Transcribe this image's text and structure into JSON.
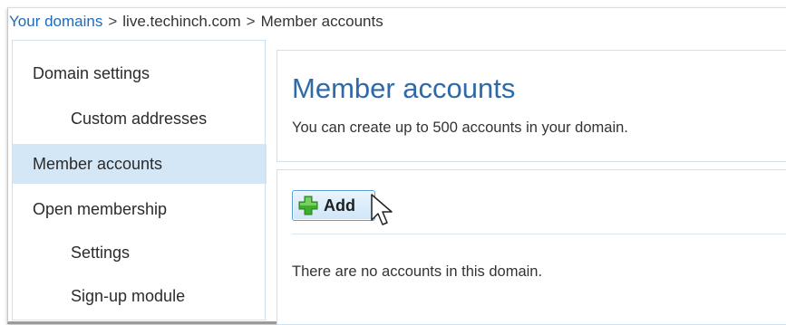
{
  "breadcrumb": {
    "root": "Your domains",
    "separator": ">",
    "domain": "live.techinch.com",
    "current": "Member accounts"
  },
  "sidebar": {
    "items": [
      {
        "label": "Domain settings",
        "level": "top",
        "active": false
      },
      {
        "label": "Custom addresses",
        "level": "sub",
        "active": false
      },
      {
        "label": "Member accounts",
        "level": "top",
        "active": true
      },
      {
        "label": "Open membership",
        "level": "top",
        "active": false
      },
      {
        "label": "Settings",
        "level": "sub",
        "active": false
      },
      {
        "label": "Sign-up module",
        "level": "sub",
        "active": false
      }
    ]
  },
  "main": {
    "title": "Member accounts",
    "description": "You can create up to 500 accounts in your domain.",
    "add_button_label": "Add",
    "empty_message": "There are no accounts in this domain."
  },
  "colors": {
    "link": "#1e6bb8",
    "title": "#2d6aa7",
    "active_bg": "#d4e7f6",
    "panel_border": "#cfe0ee",
    "plus_green": "#3fae2a"
  },
  "icons": {
    "add": "plus-icon",
    "cursor": "mouse-pointer-icon"
  }
}
